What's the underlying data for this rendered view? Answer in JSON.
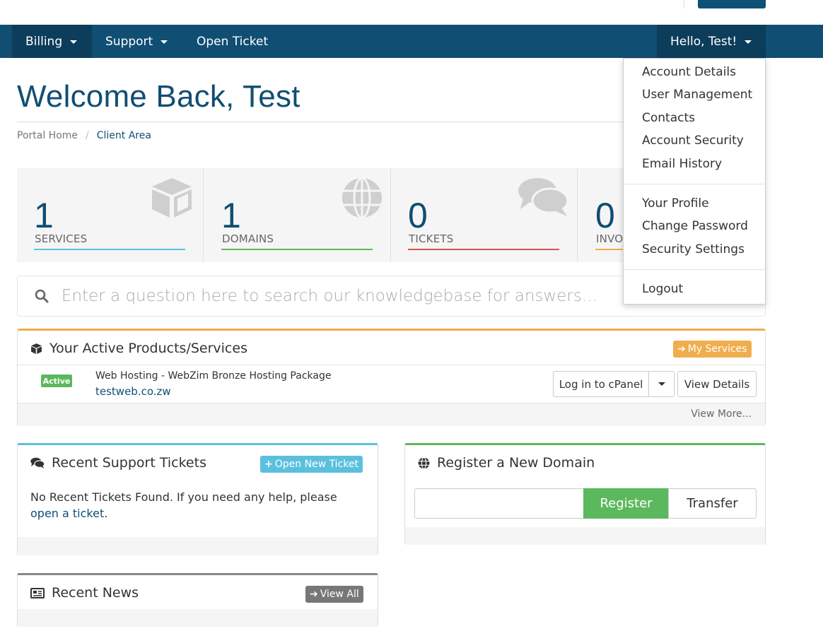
{
  "navbar": {
    "items": [
      {
        "label": "Billing",
        "has_caret": true
      },
      {
        "label": "Support",
        "has_caret": true
      },
      {
        "label": "Open Ticket",
        "has_caret": false
      }
    ],
    "user_menu_label": "Hello, Test!"
  },
  "user_dropdown": {
    "group1": [
      "Account Details",
      "User Management",
      "Contacts",
      "Account Security",
      "Email History"
    ],
    "group2": [
      "Your Profile",
      "Change Password",
      "Security Settings"
    ],
    "group3": [
      "Logout"
    ]
  },
  "page": {
    "title": "Welcome Back, Test",
    "breadcrumb": [
      "Portal Home",
      "Client Area"
    ]
  },
  "stats": [
    {
      "count": "1",
      "label": "SERVICES",
      "color": "#5bc0de",
      "icon": "cube-icon"
    },
    {
      "count": "1",
      "label": "DOMAINS",
      "color": "#5cb85c",
      "icon": "globe-icon"
    },
    {
      "count": "0",
      "label": "TICKETS",
      "color": "#d9534f",
      "icon": "comments-icon"
    },
    {
      "count": "0",
      "label": "INVO",
      "color": "#f0ad4e",
      "icon": "invoice-icon"
    }
  ],
  "kb_search": {
    "placeholder": "Enter a question here to search our knowledgebase for answers..."
  },
  "services_panel": {
    "title": "Your Active Products/Services",
    "header_button": "My Services",
    "accent": "#f0ad4e",
    "service": {
      "status": "Active",
      "name": "Web Hosting - WebZim Bronze Hosting Package",
      "domain": "testweb.co.zw",
      "login_button": "Log in to cPanel",
      "details_button": "View Details"
    },
    "footer_link": "View More..."
  },
  "tickets_panel": {
    "title": "Recent Support Tickets",
    "header_button": "Open New Ticket",
    "accent": "#5bc0de",
    "message": "No Recent Tickets Found. If you need any help, please ",
    "link": "open a ticket",
    "message_end": "."
  },
  "domain_panel": {
    "title": "Register a New Domain",
    "accent": "#5cb85c",
    "register_button": "Register",
    "transfer_button": "Transfer"
  },
  "news_panel": {
    "title": "Recent News",
    "header_button": "View All",
    "accent": "#888888"
  }
}
